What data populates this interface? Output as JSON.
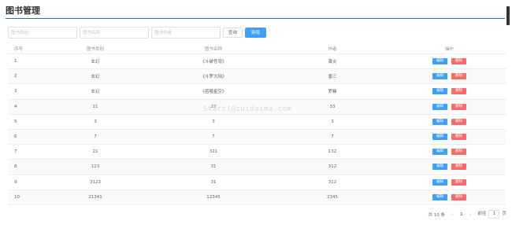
{
  "page": {
    "title": "图书管理"
  },
  "filters": {
    "category_placeholder": "图书类别",
    "name_placeholder": "图书名称",
    "author_placeholder": "图书作者",
    "search_label": "查询",
    "add_label": "新增"
  },
  "table": {
    "headers": [
      "序号",
      "图书类别",
      "图书名称",
      "作者",
      "操作"
    ],
    "rows": [
      [
        "1",
        "玄幻",
        "《斗破苍穹》",
        "萧炎"
      ],
      [
        "2",
        "玄幻",
        "《斗罗大陆》",
        "唐三"
      ],
      [
        "3",
        "玄幻",
        "《吞噬星空》",
        "罗峰"
      ],
      [
        "4",
        "11",
        "22",
        "33"
      ],
      [
        "5",
        "3",
        "3",
        "3"
      ],
      [
        "6",
        "7",
        "7",
        "7"
      ],
      [
        "7",
        "21",
        "321",
        "132"
      ],
      [
        "8",
        "123",
        "31",
        "312"
      ],
      [
        "9",
        "3123",
        "31",
        "312"
      ],
      [
        "10",
        "21341",
        "12345",
        "2345"
      ]
    ],
    "edit_label": "编辑",
    "delete_label": "删除"
  },
  "pagination": {
    "total_text": "共 10 条",
    "prev_icon": "‹",
    "current_page": "1",
    "next_icon": "›",
    "goto_prefix": "前往",
    "goto_value": "1",
    "goto_suffix": "页"
  },
  "watermark": "Start1@zuidaima.com"
}
